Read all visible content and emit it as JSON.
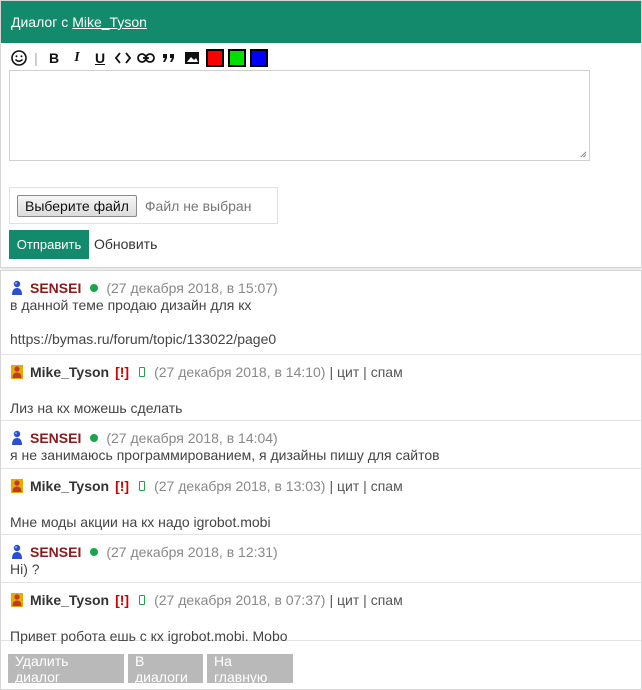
{
  "header": {
    "prefix": "Диалог с",
    "username": "Mike_Tyson"
  },
  "toolbar": {
    "items": [
      "smile-icon",
      "bold-icon",
      "italic-icon",
      "underline-icon",
      "code-icon",
      "link-icon",
      "quote-icon",
      "image-icon"
    ],
    "colors": [
      "#ff0000",
      "#00e000",
      "#0000ff"
    ]
  },
  "compose": {
    "file_button": "Выберите файл",
    "file_status": "Файл не выбран",
    "send": "Отправить",
    "refresh": "Обновить"
  },
  "messages": [
    {
      "author": "SENSEI",
      "role": "sensei",
      "status": "online",
      "time": "(27 декабря 2018, в 15:07)",
      "lines": [
        "в данной теме продаю дизайн для кх",
        "",
        "https://bymas.ru/forum/topic/133022/page0"
      ]
    },
    {
      "author": "Mike_Tyson",
      "role": "mike",
      "status": "mobile",
      "flag": "[!]",
      "time": "(27 декабря 2018, в 14:10)",
      "actions": [
        "цит",
        "спам"
      ],
      "lines": [
        "",
        "Лиз на кх можешь сделать"
      ]
    },
    {
      "author": "SENSEI",
      "role": "sensei",
      "status": "online",
      "time": "(27 декабря 2018, в 14:04)",
      "lines": [
        "я не занимаюсь программированием, я дизайны пишу для сайтов"
      ]
    },
    {
      "author": "Mike_Tyson",
      "role": "mike",
      "status": "mobile",
      "flag": "[!]",
      "time": "(27 декабря 2018, в 13:03)",
      "actions": [
        "цит",
        "спам"
      ],
      "lines": [
        "",
        "Мне моды акции на кх надо igrobot.mobi"
      ]
    },
    {
      "author": "SENSEI",
      "role": "sensei",
      "status": "online",
      "time": "(27 декабря 2018, в 12:31)",
      "lines": [
        "Hi) ?"
      ]
    },
    {
      "author": "Mike_Tyson",
      "role": "mike",
      "status": "mobile",
      "flag": "[!]",
      "time": "(27 декабря 2018, в 07:37)",
      "actions": [
        "цит",
        "спам"
      ],
      "lines": [
        "",
        "Привет робота ешь с кх igrobot.mobi. Mobo"
      ]
    }
  ],
  "footer": {
    "delete": "Удалить диалог",
    "dialogs": "В диалоги",
    "home": "На главную"
  }
}
